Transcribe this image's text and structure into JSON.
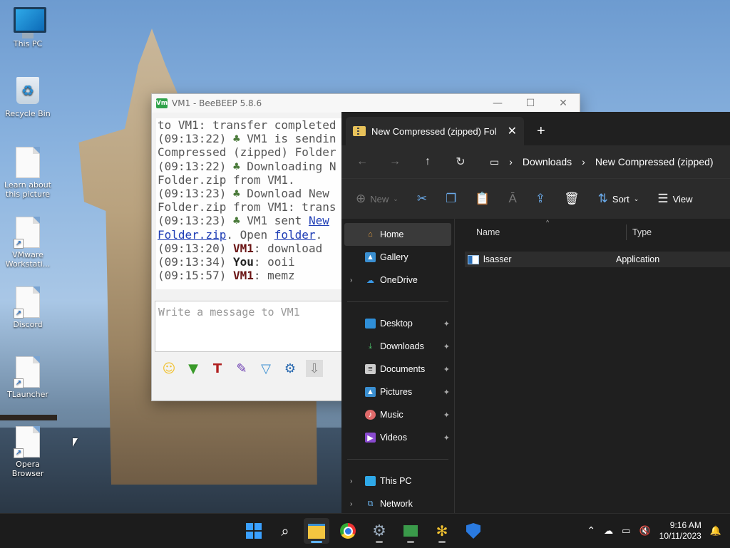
{
  "desktop": {
    "icons": [
      {
        "label": "This PC"
      },
      {
        "label": "Recycle Bin"
      },
      {
        "label": "Learn about this picture"
      },
      {
        "label": "VMware Workstati..."
      },
      {
        "label": "Discord"
      },
      {
        "label": "TLauncher"
      },
      {
        "label": "Opera Browser"
      }
    ]
  },
  "beebeep": {
    "title": "VM1 - BeeBEEP 5.8.6",
    "badge": "Vm",
    "controls": {
      "minimize": "—",
      "maximize": "☐",
      "close": "✕"
    },
    "chat": {
      "l1": "to VM1: transfer completed",
      "l2_ts": "(09:13:22)",
      "l2_text": " VM1 is sendin",
      "l3": "Compressed (zipped) Folder",
      "l4_ts": "(09:13:22)",
      "l4_text": " Downloading N",
      "l5": "Folder.zip from VM1.",
      "l6_ts": "(09:13:23)",
      "l6_text": " Download New",
      "l7": "Folder.zip from VM1: trans",
      "l8_ts": "(09:13:23)",
      "l8_text": " VM1 sent ",
      "l8_link": "New",
      "l9_link": "Folder.zip",
      "l9_mid": ". Open ",
      "l9_link2": "folder",
      "l9_end": ".",
      "l10_ts": "(09:13:20) ",
      "l10_user": "VM1",
      "l10_msg": ": download",
      "l11_ts": "(09:13:34) ",
      "l11_user": "You",
      "l11_msg": ": ooii",
      "l12_ts": "(09:15:57) ",
      "l12_user": "VM1",
      "l12_msg": ": memz"
    },
    "message_placeholder": "Write a message to VM1"
  },
  "explorer": {
    "tab_title": "New Compressed (zipped) Fol",
    "tab_close": "✕",
    "new_tab": "+",
    "breadcrumb": [
      "Downloads",
      "New Compressed (zipped)"
    ],
    "commands": {
      "new": "New",
      "sort": "Sort",
      "view": "View"
    },
    "nav": {
      "home": "Home",
      "gallery": "Gallery",
      "onedrive": "OneDrive",
      "desktop": "Desktop",
      "downloads": "Downloads",
      "documents": "Documents",
      "pictures": "Pictures",
      "music": "Music",
      "videos": "Videos",
      "thispc": "This PC",
      "network": "Network"
    },
    "columns": {
      "name": "Name",
      "type": "Type"
    },
    "files": [
      {
        "name": "lsasser",
        "type": "Application"
      }
    ]
  },
  "taskbar": {
    "time": "9:16 AM",
    "date": "10/11/2023"
  },
  "colors": {
    "accent": "#5fb2f5",
    "explorer_bg": "#1f1f1f"
  }
}
